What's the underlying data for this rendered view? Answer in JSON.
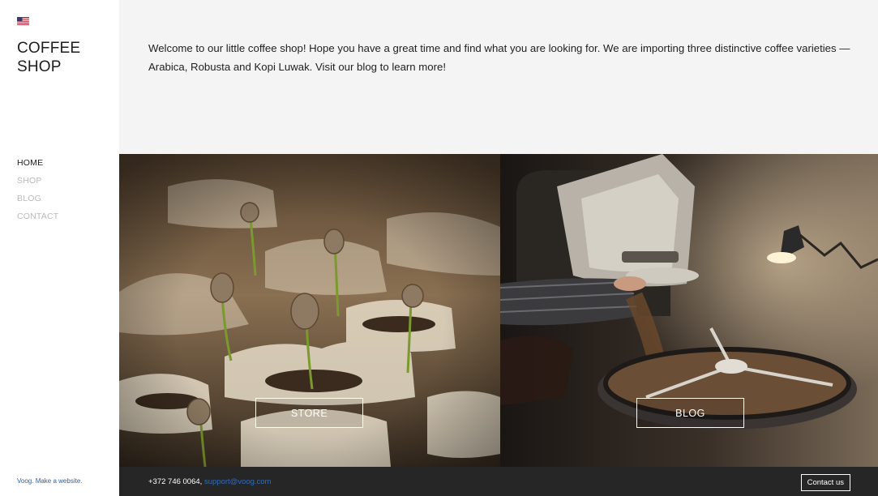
{
  "sidebar": {
    "logo_line1": "COFFEE",
    "logo_line2": "SHOP",
    "menu": [
      {
        "label": "HOME",
        "active": true
      },
      {
        "label": "SHOP",
        "active": false
      },
      {
        "label": "BLOG",
        "active": false
      },
      {
        "label": "CONTACT",
        "active": false
      }
    ],
    "credit": "Voog. Make a website."
  },
  "intro": {
    "text": "Welcome to our little coffee shop! Hope you have a great time and find what you are looking for. We are importing three distinctive coffee varieties — Arabica, Robusta and Kopi Luwak. Visit our blog to learn more!"
  },
  "tiles": {
    "store_label": "STORE",
    "blog_label": "BLOG"
  },
  "footer": {
    "phone": "+372 746 0064,",
    "email": "support@voog.com",
    "contact_button": "Contact us"
  },
  "colors": {
    "accent_link": "#2f6cc0",
    "footer_bg": "#262626",
    "intro_bg": "#f4f4f4"
  },
  "icons": {
    "language_flag": "us-flag-icon"
  }
}
